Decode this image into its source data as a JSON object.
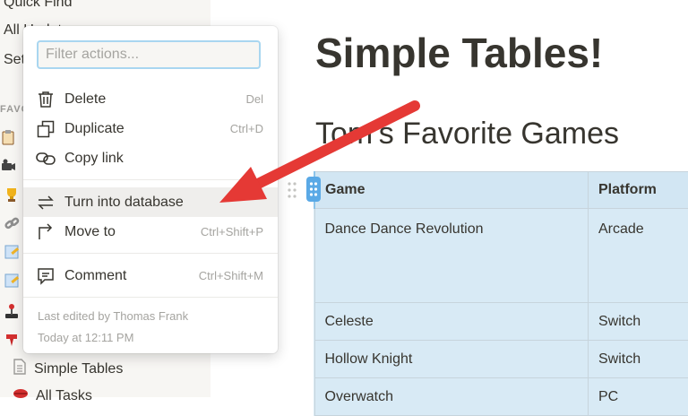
{
  "sidebar": {
    "quick_find": "Quick Find",
    "all_updates": "All Updates",
    "settings": "Settings",
    "section_label": "FAVORITES",
    "pages": [
      {
        "icon": "clipboard-icon",
        "label": ""
      },
      {
        "icon": "camera-icon",
        "label": ""
      },
      {
        "icon": "trophy-icon",
        "label": ""
      },
      {
        "icon": "link-icon",
        "label": ""
      },
      {
        "icon": "memo-icon",
        "label": ""
      },
      {
        "icon": "memo-icon",
        "label": ""
      },
      {
        "icon": "joystick-icon",
        "label": ""
      },
      {
        "icon": "pin-icon",
        "label": ""
      },
      {
        "icon": "page-icon",
        "label": "Simple Tables"
      },
      {
        "icon": "lips-icon",
        "label": "All Tasks"
      }
    ]
  },
  "main": {
    "title": "Simple Tables!",
    "heading": "Tom's Favorite Games",
    "table": {
      "headers": [
        "Game",
        "Platform"
      ],
      "rows": [
        [
          "Dance Dance Revolution",
          "Arcade"
        ],
        [
          "Celeste",
          "Switch"
        ],
        [
          "Hollow Knight",
          "Switch"
        ],
        [
          "Overwatch",
          "PC"
        ]
      ]
    }
  },
  "menu": {
    "filter_placeholder": "Filter actions...",
    "items": [
      {
        "label": "Delete",
        "shortcut": "Del",
        "icon": "trash-icon"
      },
      {
        "label": "Duplicate",
        "shortcut": "Ctrl+D",
        "icon": "duplicate-icon"
      },
      {
        "label": "Copy link",
        "shortcut": "",
        "icon": "link-icon"
      },
      {
        "label": "Turn into database",
        "shortcut": "",
        "icon": "convert-icon"
      },
      {
        "label": "Move to",
        "shortcut": "Ctrl+Shift+P",
        "icon": "move-icon"
      },
      {
        "label": "Comment",
        "shortcut": "Ctrl+Shift+M",
        "icon": "comment-icon"
      }
    ],
    "last_edited_by": "Last edited by Thomas Frank",
    "last_edited_time": "Today at 12:11 PM"
  },
  "colors": {
    "annotation_arrow": "#e53935",
    "table_bg": "#d8eaf5",
    "handle": "#5aa9e6"
  }
}
